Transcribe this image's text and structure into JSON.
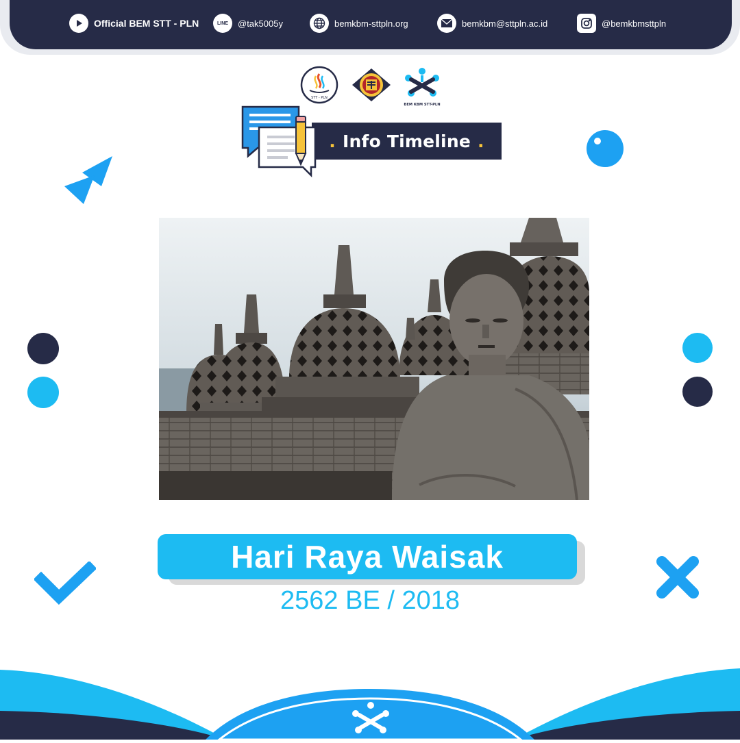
{
  "header": {
    "official": {
      "label": "Official BEM STT - PLN",
      "icon": "play-icon"
    },
    "line": {
      "label": "@tak5005y",
      "icon": "line-icon"
    },
    "website": {
      "label": "bemkbm-sttpln.org",
      "icon": "globe-icon"
    },
    "email": {
      "label": "bemkbm@sttpln.ac.id",
      "icon": "mail-icon"
    },
    "instagram": {
      "label": "@bemkbmsttpln",
      "icon": "instagram-icon"
    }
  },
  "logos": [
    {
      "name": "stt-pln-logo",
      "text": "STT - PLN"
    },
    {
      "name": "bem-emblem-logo",
      "text": ""
    },
    {
      "name": "bem-kbm-stt-pln-logo",
      "text": "BEM KBM STT-PLN"
    }
  ],
  "banner": {
    "title": "Info Timeline"
  },
  "main": {
    "title": "Hari Raya Waisak",
    "subtitle": "2562 BE / 2018"
  },
  "colors": {
    "navy": "#262b47",
    "accent_blue": "#1dbbf2",
    "yellow": "#f6c33a"
  }
}
